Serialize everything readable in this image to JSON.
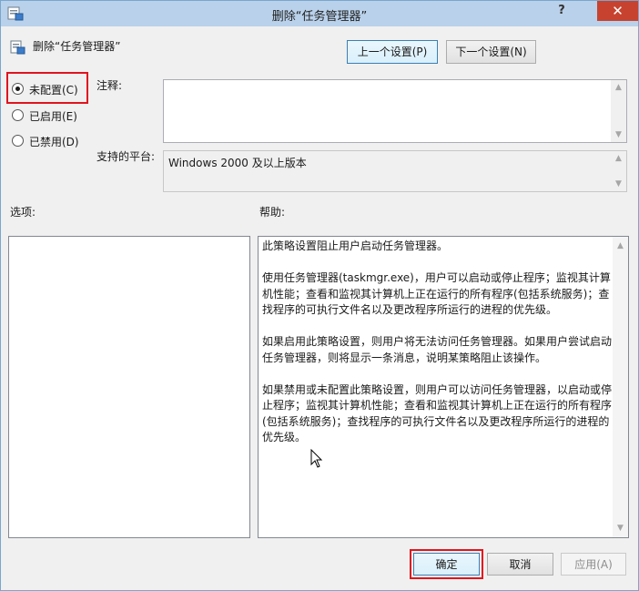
{
  "window": {
    "title": "删除“任务管理器”",
    "close_symbol": "✕",
    "help_symbol": "?"
  },
  "header": {
    "policy_name": "删除“任务管理器”",
    "icon": "policy-setting-icon"
  },
  "nav": {
    "prev_label": "上一个设置(P)",
    "next_label": "下一个设置(N)"
  },
  "state": {
    "options": [
      {
        "label": "未配置(C)",
        "checked": true
      },
      {
        "label": "已启用(E)",
        "checked": false
      },
      {
        "label": "已禁用(D)",
        "checked": false
      }
    ]
  },
  "comment": {
    "label": "注释:",
    "value": ""
  },
  "platform": {
    "label": "支持的平台:",
    "value": "Windows 2000 及以上版本"
  },
  "options_pane": {
    "label": "选项:"
  },
  "help_pane": {
    "label": "帮助:",
    "paragraphs": [
      "此策略设置阻止用户启动任务管理器。",
      "使用任务管理器(taskmgr.exe)，用户可以启动或停止程序；监视其计算机性能；查看和监视其计算机上正在运行的所有程序(包括系统服务)；查找程序的可执行文件名以及更改程序所运行的进程的优先级。",
      "如果启用此策略设置，则用户将无法访问任务管理器。如果用户尝试启动任务管理器，则将显示一条消息，说明某策略阻止该操作。",
      "如果禁用或未配置此策略设置，则用户可以访问任务管理器，以启动或停止程序；监视其计算机性能；查看和监视其计算机上正在运行的所有程序(包括系统服务)；查找程序的可执行文件名以及更改程序所运行的进程的优先级。"
    ]
  },
  "footer": {
    "ok_label": "确定",
    "cancel_label": "取消",
    "apply_label": "应用(A)"
  },
  "colors": {
    "highlight_box": "#e0141e",
    "titlebar": "#b9d1ea",
    "close_button": "#c7432f"
  }
}
